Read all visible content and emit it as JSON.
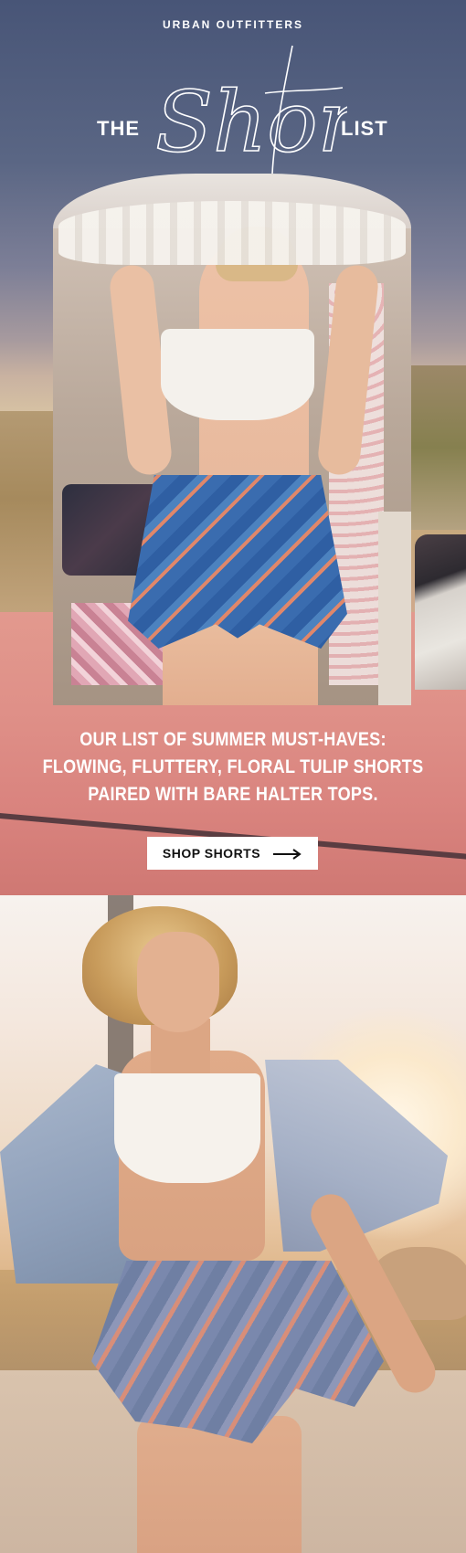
{
  "brand": {
    "name": "URBAN OUTFITTERS"
  },
  "headline": {
    "prefix": "THE",
    "script_word": "Short",
    "suffix": "LIST"
  },
  "hero_image": {
    "alt": "model in lace halter top and floral tulip shorts under van awning"
  },
  "copy": {
    "line1": "OUR LIST OF SUMMER MUST-HAVES:",
    "line2": "FLOWING, FLUTTERY, FLORAL TULIP SHORTS",
    "line3": "PAIRED WITH BARE HALTER TOPS."
  },
  "cta": {
    "label": "SHOP SHORTS",
    "icon": "arrow-right-icon"
  },
  "second_image": {
    "alt": "model in desert wearing denim jacket, halter top and floral shorts"
  },
  "colors": {
    "sky_top": "#485577",
    "car_pink": "#df9088",
    "text": "#ffffff",
    "cta_bg": "#ffffff",
    "cta_text": "#111111"
  }
}
